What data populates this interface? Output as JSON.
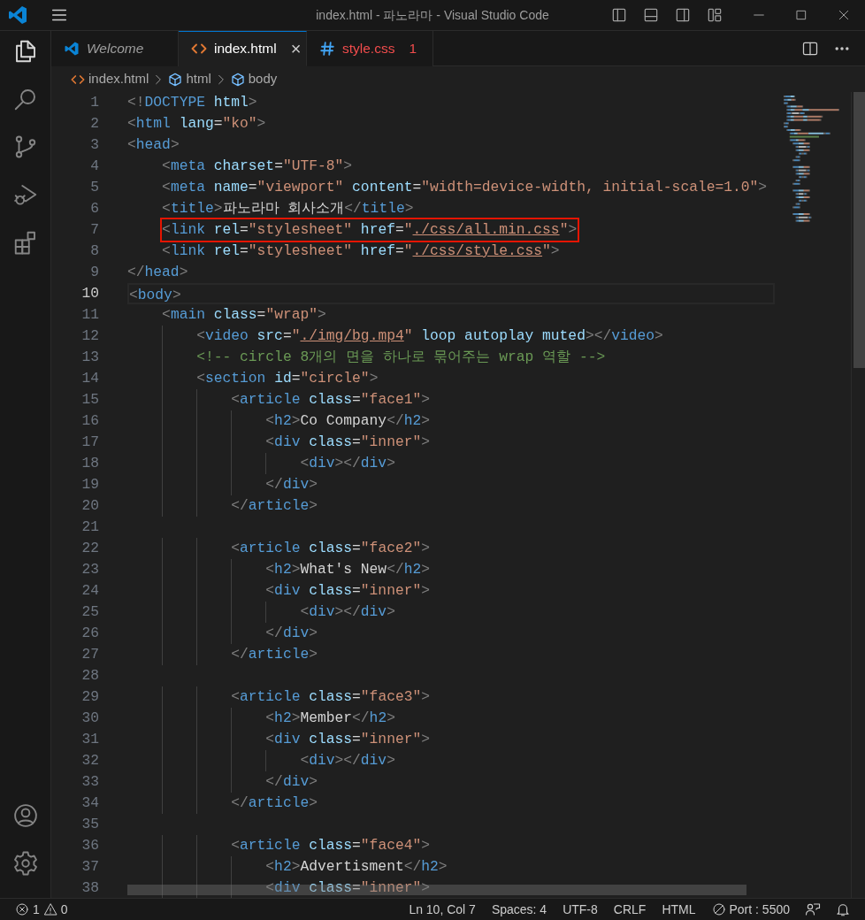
{
  "window": {
    "title": "index.html - 파노라마 - Visual Studio Code"
  },
  "activity_bar": {
    "top": [
      {
        "kind": "explorer",
        "selected": true
      },
      {
        "kind": "search",
        "selected": false
      },
      {
        "kind": "source_control",
        "selected": false
      },
      {
        "kind": "run_debug",
        "selected": false
      },
      {
        "kind": "extensions",
        "selected": false
      }
    ],
    "bottom": [
      {
        "kind": "account"
      },
      {
        "kind": "settings"
      }
    ]
  },
  "tabs": [
    {
      "kind": "welcome",
      "label": "Welcome",
      "preview": true,
      "selected": false
    },
    {
      "kind": "html",
      "label": "index.html",
      "preview": false,
      "selected": true,
      "close": "×"
    },
    {
      "kind": "css",
      "label": "style.css",
      "preview": false,
      "selected": false,
      "problems": "1"
    }
  ],
  "breadcrumbs": [
    {
      "kind": "file",
      "label": "index.html"
    },
    {
      "kind": "symbol",
      "label": "html"
    },
    {
      "kind": "symbol",
      "label": "body"
    }
  ],
  "editor": {
    "lines": [
      {
        "number": "1",
        "current": false,
        "highlighted": false,
        "code": [
          {
            "kind": "punct",
            "text": "<!"
          },
          {
            "kind": "tag",
            "text": "DOCTYPE"
          },
          {
            "kind": "attr",
            "text": " html"
          },
          {
            "kind": "punct",
            "text": ">"
          }
        ]
      },
      {
        "number": "2",
        "current": false,
        "highlighted": false,
        "code": [
          {
            "kind": "punct",
            "text": "<"
          },
          {
            "kind": "tag",
            "text": "html"
          },
          {
            "kind": "attr",
            "text": " lang"
          },
          {
            "kind": "text",
            "text": "="
          },
          {
            "kind": "string",
            "text": "\"ko\""
          },
          {
            "kind": "punct",
            "text": ">"
          }
        ]
      },
      {
        "number": "3",
        "current": false,
        "highlighted": false,
        "code": [
          {
            "kind": "punct",
            "text": "<"
          },
          {
            "kind": "tag",
            "text": "head"
          },
          {
            "kind": "punct",
            "text": ">"
          }
        ]
      },
      {
        "number": "4",
        "current": false,
        "highlighted": false,
        "code": [
          {
            "kind": "punct",
            "text": "    <"
          },
          {
            "kind": "tag",
            "text": "meta"
          },
          {
            "kind": "attr",
            "text": " charset"
          },
          {
            "kind": "text",
            "text": "="
          },
          {
            "kind": "string",
            "text": "\"UTF-8\""
          },
          {
            "kind": "punct",
            "text": ">"
          }
        ]
      },
      {
        "number": "5",
        "current": false,
        "highlighted": false,
        "code": [
          {
            "kind": "punct",
            "text": "    <"
          },
          {
            "kind": "tag",
            "text": "meta"
          },
          {
            "kind": "attr",
            "text": " name"
          },
          {
            "kind": "text",
            "text": "="
          },
          {
            "kind": "string",
            "text": "\"viewport\""
          },
          {
            "kind": "attr",
            "text": " content"
          },
          {
            "kind": "text",
            "text": "="
          },
          {
            "kind": "string",
            "text": "\"width=device-width, initial-scale=1.0\""
          },
          {
            "kind": "punct",
            "text": ">"
          }
        ]
      },
      {
        "number": "6",
        "current": false,
        "highlighted": false,
        "code": [
          {
            "kind": "punct",
            "text": "    <"
          },
          {
            "kind": "tag",
            "text": "title"
          },
          {
            "kind": "punct",
            "text": ">"
          },
          {
            "kind": "text",
            "text": "파노라마 회사소개"
          },
          {
            "kind": "punct",
            "text": "</"
          },
          {
            "kind": "tag",
            "text": "title"
          },
          {
            "kind": "punct",
            "text": ">"
          }
        ]
      },
      {
        "number": "7",
        "current": false,
        "highlighted": true,
        "code": [
          {
            "kind": "punct",
            "text": "    <"
          },
          {
            "kind": "tag",
            "text": "link"
          },
          {
            "kind": "attr",
            "text": " rel"
          },
          {
            "kind": "text",
            "text": "="
          },
          {
            "kind": "string",
            "text": "\"stylesheet\""
          },
          {
            "kind": "attr",
            "text": " href"
          },
          {
            "kind": "text",
            "text": "="
          },
          {
            "kind": "string",
            "text": "\""
          },
          {
            "kind": "link",
            "text": "./css/all.min.css"
          },
          {
            "kind": "string",
            "text": "\""
          },
          {
            "kind": "punct",
            "text": ">"
          }
        ]
      },
      {
        "number": "8",
        "current": false,
        "highlighted": false,
        "code": [
          {
            "kind": "punct",
            "text": "    <"
          },
          {
            "kind": "tag",
            "text": "link"
          },
          {
            "kind": "attr",
            "text": " rel"
          },
          {
            "kind": "text",
            "text": "="
          },
          {
            "kind": "string",
            "text": "\"stylesheet\""
          },
          {
            "kind": "attr",
            "text": " href"
          },
          {
            "kind": "text",
            "text": "="
          },
          {
            "kind": "string",
            "text": "\""
          },
          {
            "kind": "link",
            "text": "./css/style.css"
          },
          {
            "kind": "string",
            "text": "\""
          },
          {
            "kind": "punct",
            "text": ">"
          }
        ]
      },
      {
        "number": "9",
        "current": false,
        "highlighted": false,
        "code": [
          {
            "kind": "punct",
            "text": "</"
          },
          {
            "kind": "tag",
            "text": "head"
          },
          {
            "kind": "punct",
            "text": ">"
          }
        ]
      },
      {
        "number": "10",
        "current": true,
        "highlighted": false,
        "code": [
          {
            "kind": "punct",
            "text": "<"
          },
          {
            "kind": "tag",
            "text": "body"
          },
          {
            "kind": "punct",
            "text": ">"
          }
        ]
      },
      {
        "number": "11",
        "current": false,
        "highlighted": false,
        "code": [
          {
            "kind": "punct",
            "text": "    <"
          },
          {
            "kind": "tag",
            "text": "main"
          },
          {
            "kind": "attr",
            "text": " class"
          },
          {
            "kind": "text",
            "text": "="
          },
          {
            "kind": "string",
            "text": "\"wrap\""
          },
          {
            "kind": "punct",
            "text": ">"
          }
        ]
      },
      {
        "number": "12",
        "current": false,
        "highlighted": false,
        "code": [
          {
            "kind": "punct",
            "text": "        <"
          },
          {
            "kind": "tag",
            "text": "video"
          },
          {
            "kind": "attr",
            "text": " src"
          },
          {
            "kind": "text",
            "text": "="
          },
          {
            "kind": "string",
            "text": "\""
          },
          {
            "kind": "link",
            "text": "./img/bg.mp4"
          },
          {
            "kind": "string",
            "text": "\""
          },
          {
            "kind": "attr",
            "text": " loop autoplay muted"
          },
          {
            "kind": "punct",
            "text": "></"
          },
          {
            "kind": "tag",
            "text": "video"
          },
          {
            "kind": "punct",
            "text": ">"
          }
        ]
      },
      {
        "number": "13",
        "current": false,
        "highlighted": false,
        "code": [
          {
            "kind": "comment",
            "text": "        <!-- circle 8개의 면을 하나로 묶어주는 wrap 역할 -->"
          }
        ]
      },
      {
        "number": "14",
        "current": false,
        "highlighted": false,
        "code": [
          {
            "kind": "punct",
            "text": "        <"
          },
          {
            "kind": "tag",
            "text": "section"
          },
          {
            "kind": "attr",
            "text": " id"
          },
          {
            "kind": "text",
            "text": "="
          },
          {
            "kind": "string",
            "text": "\"circle\""
          },
          {
            "kind": "punct",
            "text": ">"
          }
        ]
      },
      {
        "number": "15",
        "current": false,
        "highlighted": false,
        "code": [
          {
            "kind": "punct",
            "text": "            <"
          },
          {
            "kind": "tag",
            "text": "article"
          },
          {
            "kind": "attr",
            "text": " class"
          },
          {
            "kind": "text",
            "text": "="
          },
          {
            "kind": "string",
            "text": "\"face1\""
          },
          {
            "kind": "punct",
            "text": ">"
          }
        ]
      },
      {
        "number": "16",
        "current": false,
        "highlighted": false,
        "code": [
          {
            "kind": "punct",
            "text": "                <"
          },
          {
            "kind": "tag",
            "text": "h2"
          },
          {
            "kind": "punct",
            "text": ">"
          },
          {
            "kind": "text",
            "text": "Co Company"
          },
          {
            "kind": "punct",
            "text": "</"
          },
          {
            "kind": "tag",
            "text": "h2"
          },
          {
            "kind": "punct",
            "text": ">"
          }
        ]
      },
      {
        "number": "17",
        "current": false,
        "highlighted": false,
        "code": [
          {
            "kind": "punct",
            "text": "                <"
          },
          {
            "kind": "tag",
            "text": "div"
          },
          {
            "kind": "attr",
            "text": " class"
          },
          {
            "kind": "text",
            "text": "="
          },
          {
            "kind": "string",
            "text": "\"inner\""
          },
          {
            "kind": "punct",
            "text": ">"
          }
        ]
      },
      {
        "number": "18",
        "current": false,
        "highlighted": false,
        "code": [
          {
            "kind": "punct",
            "text": "                    <"
          },
          {
            "kind": "tag",
            "text": "div"
          },
          {
            "kind": "punct",
            "text": "></"
          },
          {
            "kind": "tag",
            "text": "div"
          },
          {
            "kind": "punct",
            "text": ">"
          }
        ]
      },
      {
        "number": "19",
        "current": false,
        "highlighted": false,
        "code": [
          {
            "kind": "punct",
            "text": "                </"
          },
          {
            "kind": "tag",
            "text": "div"
          },
          {
            "kind": "punct",
            "text": ">"
          }
        ]
      },
      {
        "number": "20",
        "current": false,
        "highlighted": false,
        "code": [
          {
            "kind": "punct",
            "text": "            </"
          },
          {
            "kind": "tag",
            "text": "article"
          },
          {
            "kind": "punct",
            "text": ">"
          }
        ]
      },
      {
        "number": "21",
        "current": false,
        "highlighted": false
      },
      {
        "number": "22",
        "current": false,
        "highlighted": false,
        "code": [
          {
            "kind": "punct",
            "text": "            <"
          },
          {
            "kind": "tag",
            "text": "article"
          },
          {
            "kind": "attr",
            "text": " class"
          },
          {
            "kind": "text",
            "text": "="
          },
          {
            "kind": "string",
            "text": "\"face2\""
          },
          {
            "kind": "punct",
            "text": ">"
          }
        ]
      },
      {
        "number": "23",
        "current": false,
        "highlighted": false,
        "code": [
          {
            "kind": "punct",
            "text": "                <"
          },
          {
            "kind": "tag",
            "text": "h2"
          },
          {
            "kind": "punct",
            "text": ">"
          },
          {
            "kind": "text",
            "text": "What's New"
          },
          {
            "kind": "punct",
            "text": "</"
          },
          {
            "kind": "tag",
            "text": "h2"
          },
          {
            "kind": "punct",
            "text": ">"
          }
        ]
      },
      {
        "number": "24",
        "current": false,
        "highlighted": false,
        "code": [
          {
            "kind": "punct",
            "text": "                <"
          },
          {
            "kind": "tag",
            "text": "div"
          },
          {
            "kind": "attr",
            "text": " class"
          },
          {
            "kind": "text",
            "text": "="
          },
          {
            "kind": "string",
            "text": "\"inner\""
          },
          {
            "kind": "punct",
            "text": ">"
          }
        ]
      },
      {
        "number": "25",
        "current": false,
        "highlighted": false,
        "code": [
          {
            "kind": "punct",
            "text": "                    <"
          },
          {
            "kind": "tag",
            "text": "div"
          },
          {
            "kind": "punct",
            "text": "></"
          },
          {
            "kind": "tag",
            "text": "div"
          },
          {
            "kind": "punct",
            "text": ">"
          }
        ]
      },
      {
        "number": "26",
        "current": false,
        "highlighted": false,
        "code": [
          {
            "kind": "punct",
            "text": "                </"
          },
          {
            "kind": "tag",
            "text": "div"
          },
          {
            "kind": "punct",
            "text": ">"
          }
        ]
      },
      {
        "number": "27",
        "current": false,
        "highlighted": false,
        "code": [
          {
            "kind": "punct",
            "text": "            </"
          },
          {
            "kind": "tag",
            "text": "article"
          },
          {
            "kind": "punct",
            "text": ">"
          }
        ]
      },
      {
        "number": "28",
        "current": false,
        "highlighted": false
      },
      {
        "number": "29",
        "current": false,
        "highlighted": false,
        "code": [
          {
            "kind": "punct",
            "text": "            <"
          },
          {
            "kind": "tag",
            "text": "article"
          },
          {
            "kind": "attr",
            "text": " class"
          },
          {
            "kind": "text",
            "text": "="
          },
          {
            "kind": "string",
            "text": "\"face3\""
          },
          {
            "kind": "punct",
            "text": ">"
          }
        ]
      },
      {
        "number": "30",
        "current": false,
        "highlighted": false,
        "code": [
          {
            "kind": "punct",
            "text": "                <"
          },
          {
            "kind": "tag",
            "text": "h2"
          },
          {
            "kind": "punct",
            "text": ">"
          },
          {
            "kind": "text",
            "text": "Member"
          },
          {
            "kind": "punct",
            "text": "</"
          },
          {
            "kind": "tag",
            "text": "h2"
          },
          {
            "kind": "punct",
            "text": ">"
          }
        ]
      },
      {
        "number": "31",
        "current": false,
        "highlighted": false,
        "code": [
          {
            "kind": "punct",
            "text": "                <"
          },
          {
            "kind": "tag",
            "text": "div"
          },
          {
            "kind": "attr",
            "text": " class"
          },
          {
            "kind": "text",
            "text": "="
          },
          {
            "kind": "string",
            "text": "\"inner\""
          },
          {
            "kind": "punct",
            "text": ">"
          }
        ]
      },
      {
        "number": "32",
        "current": false,
        "highlighted": false,
        "code": [
          {
            "kind": "punct",
            "text": "                    <"
          },
          {
            "kind": "tag",
            "text": "div"
          },
          {
            "kind": "punct",
            "text": "></"
          },
          {
            "kind": "tag",
            "text": "div"
          },
          {
            "kind": "punct",
            "text": ">"
          }
        ]
      },
      {
        "number": "33",
        "current": false,
        "highlighted": false,
        "code": [
          {
            "kind": "punct",
            "text": "                </"
          },
          {
            "kind": "tag",
            "text": "div"
          },
          {
            "kind": "punct",
            "text": ">"
          }
        ]
      },
      {
        "number": "34",
        "current": false,
        "highlighted": false,
        "code": [
          {
            "kind": "punct",
            "text": "            </"
          },
          {
            "kind": "tag",
            "text": "article"
          },
          {
            "kind": "punct",
            "text": ">"
          }
        ]
      },
      {
        "number": "35",
        "current": false,
        "highlighted": false
      },
      {
        "number": "36",
        "current": false,
        "highlighted": false,
        "code": [
          {
            "kind": "punct",
            "text": "            <"
          },
          {
            "kind": "tag",
            "text": "article"
          },
          {
            "kind": "attr",
            "text": " class"
          },
          {
            "kind": "text",
            "text": "="
          },
          {
            "kind": "string",
            "text": "\"face4\""
          },
          {
            "kind": "punct",
            "text": ">"
          }
        ]
      },
      {
        "number": "37",
        "current": false,
        "highlighted": false,
        "code": [
          {
            "kind": "punct",
            "text": "                <"
          },
          {
            "kind": "tag",
            "text": "h2"
          },
          {
            "kind": "punct",
            "text": ">"
          },
          {
            "kind": "text",
            "text": "Advertisment"
          },
          {
            "kind": "punct",
            "text": "</"
          },
          {
            "kind": "tag",
            "text": "h2"
          },
          {
            "kind": "punct",
            "text": ">"
          }
        ]
      },
      {
        "number": "38",
        "current": false,
        "highlighted": false,
        "code": [
          {
            "kind": "punct",
            "text": "                <"
          },
          {
            "kind": "tag",
            "text": "div"
          },
          {
            "kind": "attr",
            "text": " class"
          },
          {
            "kind": "text",
            "text": "="
          },
          {
            "kind": "string",
            "text": "\"inner\""
          },
          {
            "kind": "punct",
            "text": ">"
          }
        ]
      }
    ]
  },
  "status_bar": {
    "problems": {
      "errors": "1",
      "warnings": "0"
    },
    "items": [
      {
        "kind": "text",
        "text": "Ln 10, Col 7"
      },
      {
        "kind": "text",
        "text": "Spaces: 4"
      },
      {
        "kind": "text",
        "text": "UTF-8"
      },
      {
        "kind": "text",
        "text": "CRLF"
      },
      {
        "kind": "text",
        "text": "HTML"
      },
      {
        "kind": "port",
        "text": "Port : 5500"
      },
      {
        "kind": "feedback"
      },
      {
        "kind": "bell"
      }
    ]
  }
}
